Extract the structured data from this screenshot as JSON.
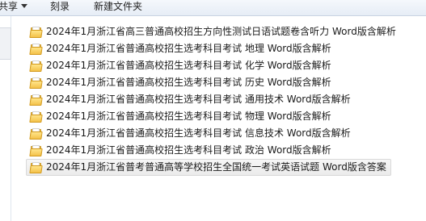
{
  "toolbar": {
    "share_label": "共享",
    "burn_label": "刻录",
    "new_folder_label": "新建文件夹"
  },
  "files": [
    {
      "name": "2024年1月浙江省高三普通高校招生方向性测试日语试题卷含听力 Word版含解析"
    },
    {
      "name": "2024年1月浙江省普通高校招生选考科目考试  地理  Word版含解析"
    },
    {
      "name": "2024年1月浙江省普通高校招生选考科目考试  化学  Word版含解析"
    },
    {
      "name": "2024年1月浙江省普通高校招生选考科目考试  历史  Word版含解析"
    },
    {
      "name": "2024年1月浙江省普通高校招生选考科目考试  通用技术  Word版含解析"
    },
    {
      "name": "2024年1月浙江省普通高校招生选考科目考试  物理  Word版含解析"
    },
    {
      "name": "2024年1月浙江省普通高校招生选考科目考试  信息技术  Word版含解析"
    },
    {
      "name": "2024年1月浙江省普通高校招生选考科目考试  政治  Word版含解析"
    },
    {
      "name": "2024年1月浙江省普考普通高等学校招生全国统一考试英语试题  Word版含答案",
      "selected": true
    }
  ]
}
